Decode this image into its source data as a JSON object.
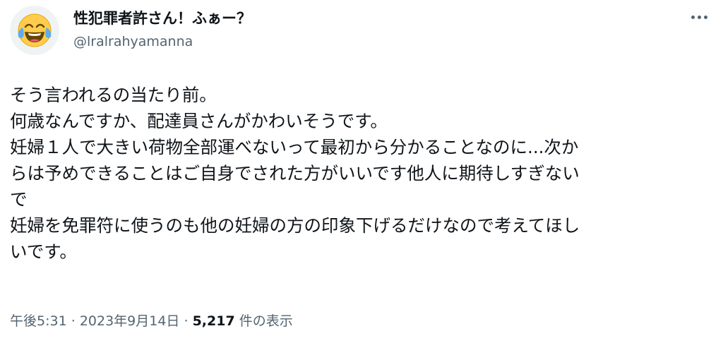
{
  "author": {
    "display_name": "性犯罪者許さん！ふぁー？",
    "handle": "@lralrahyamanna",
    "avatar_icon": "tears-of-joy-emoji-icon"
  },
  "tweet": {
    "lines": [
      "そう言われるの当たり前。",
      "何歳なんですか、配達員さんがかわいそうです。",
      "妊婦１人で大きい荷物全部運べないって最初から分かることなのに...次か",
      "らは予めできることはご自身でされた方がいいです他人に期待しすぎない",
      "で",
      "妊婦を免罪符に使うのも他の妊婦の方の印象下げるだけなので考えてほし",
      "いです。"
    ]
  },
  "meta": {
    "time": "午後5:31",
    "separator": "·",
    "date": "2023年9月14日",
    "views_count": "5,217",
    "views_label": "件の表示"
  },
  "colors": {
    "text": "#0f1419",
    "secondary": "#536471"
  }
}
